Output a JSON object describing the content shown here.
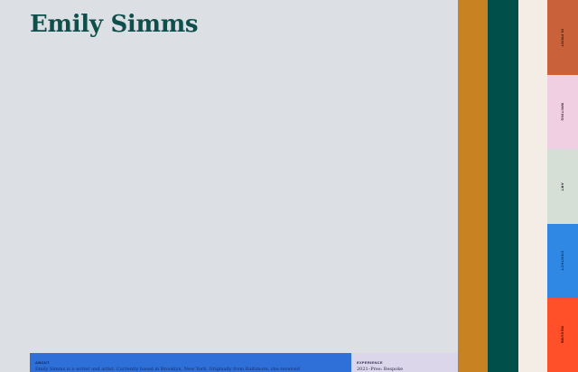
{
  "site": {
    "title": "Emily Simms"
  },
  "about": {
    "heading": "ABOUT",
    "text": "Emily Simms is a writer and artist. Currently based in Brooklyn, New York. Originally from Baltimore, she received"
  },
  "experience": {
    "heading": "EXPERIENCE",
    "text": "2021–Pres: Bespoke"
  },
  "stripes": {
    "colors": [
      "#c98221",
      "#004f4b",
      "#f3ede6"
    ]
  },
  "tabs": [
    {
      "label": "IN PRINT",
      "color": "#c9623a",
      "text_color": "#2a1a10"
    },
    {
      "label": "WRITING",
      "color": "#f1cfe2",
      "text_color": "#3a2a35"
    },
    {
      "label": "ART",
      "color": "#d5dfd5",
      "text_color": "#223"
    },
    {
      "label": "CONTACT",
      "color": "#2f89e4",
      "text_color": "#0d2a55"
    },
    {
      "label": "RESUME",
      "color": "#ff5029",
      "text_color": "#3a0d00"
    }
  ]
}
